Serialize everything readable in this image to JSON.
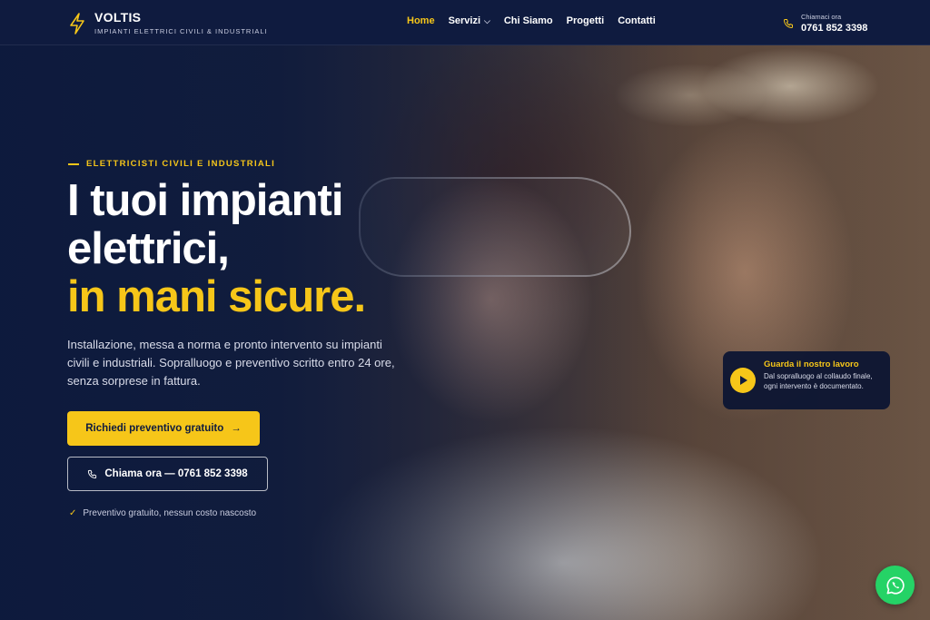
{
  "brand": {
    "name": "VOLTIS",
    "tagline": "IMPIANTI ELETTRICI CIVILI & INDUSTRIALI",
    "accent": "#f6c619",
    "navy": "#0f1b3f"
  },
  "nav": {
    "items": [
      {
        "label": "Home",
        "active": true
      },
      {
        "label": "Servizi",
        "has_dropdown": true
      },
      {
        "label": "Chi Siamo"
      },
      {
        "label": "Progetti"
      },
      {
        "label": "Contatti"
      }
    ]
  },
  "header_phone": {
    "label": "Chiamaci ora",
    "number": "0761 852 3398",
    "icon": "phone-icon"
  },
  "hero": {
    "eyebrow": "ELETTRICISTI CIVILI E INDUSTRIALI",
    "title_line1": "I tuoi impianti",
    "title_line2": "elettrici,",
    "title_line3": "in mani sicure.",
    "description": "Installazione, messa a norma e pronto intervento su impianti civili e industriali. Sopralluogo e preventivo scritto entro 24 ore, senza sorprese in fattura.",
    "primary_cta": "Richiedi preventivo gratuito",
    "secondary_cta": "Chiama ora — 0761 852 3398",
    "note": "Preventivo gratuito, nessun costo nascosto"
  },
  "video_card": {
    "title": "Guarda il nostro lavoro",
    "subtitle": "Dal sopralluogo al collaudo finale, ogni intervento è documentato.",
    "icon": "play-icon"
  },
  "whatsapp": {
    "icon": "whatsapp-icon",
    "color": "#25d366"
  }
}
